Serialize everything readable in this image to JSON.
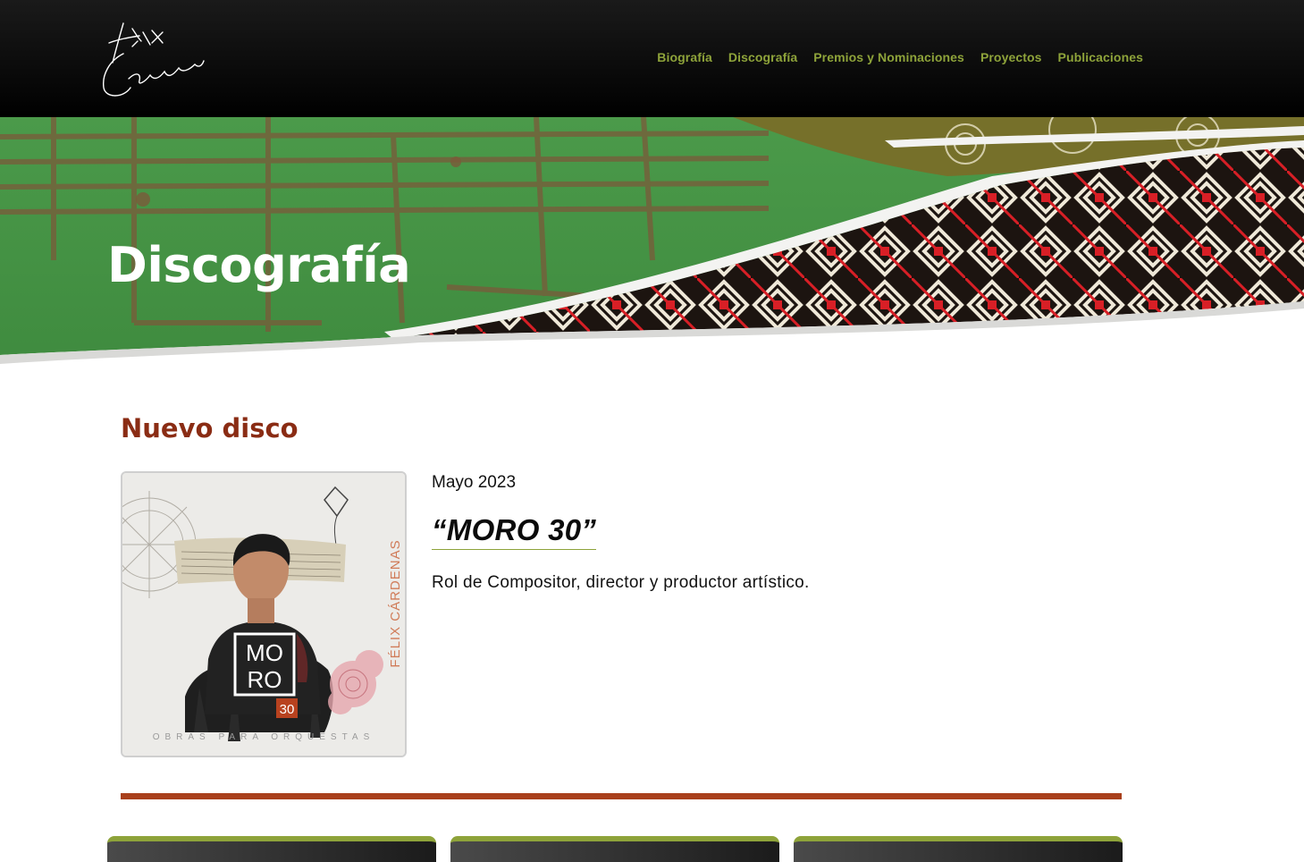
{
  "header": {
    "logo_alt": "Félix Cárdenas",
    "nav": [
      {
        "label": "Biografía"
      },
      {
        "label": "Discografía"
      },
      {
        "label": "Premios y Nominaciones"
      },
      {
        "label": "Proyectos"
      },
      {
        "label": "Publicaciones"
      }
    ],
    "nav_color": "#8ea33a"
  },
  "hero": {
    "title": "Discografía"
  },
  "main": {
    "section_heading": "Nuevo disco",
    "album": {
      "date": "Mayo 2023",
      "title": "“MORO 30”",
      "role": "Rol de Compositor, director y productor artístico.",
      "cover": {
        "artist": "FÉLIX CÁRDENAS",
        "word1": "MO",
        "word2": "RO",
        "number": "30",
        "subtitle": "OBRAS PARA ORQUESTAS"
      }
    }
  },
  "colors": {
    "heading": "#8a2c14",
    "divider": "#a9401c",
    "accent_green": "#8ea33a"
  }
}
